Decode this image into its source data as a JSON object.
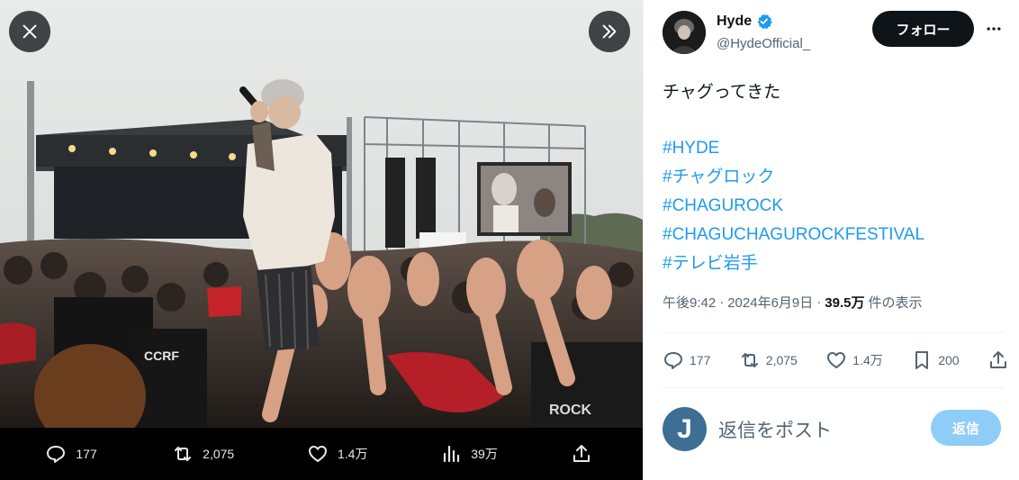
{
  "media_viewer": {
    "actions": {
      "reply_count": "177",
      "repost_count": "2,075",
      "like_count": "1.4万",
      "views_count": "39万"
    }
  },
  "author": {
    "display_name": "Hyde",
    "handle": "@HydeOfficial_",
    "follow_label": "フォロー"
  },
  "tweet": {
    "text": "チャグってきた",
    "hashtags": [
      "#HYDE",
      "#チャグロック",
      "#CHAGUROCK",
      "#CHAGUCHAGUROCKFESTIVAL",
      "#テレビ岩手"
    ],
    "time": "午後9:42",
    "separator": "·",
    "date": "2024年6月9日",
    "views": "39.5万",
    "views_label": "件の表示"
  },
  "stats": {
    "replies": "177",
    "reposts": "2,075",
    "likes": "1.4万",
    "bookmarks": "200"
  },
  "reply": {
    "avatar_initial": "J",
    "placeholder": "返信をポスト",
    "button_label": "返信"
  },
  "colors": {
    "accent": "#1d9bf0",
    "verified": "#1d9bf0",
    "follow_bg": "#0f1419",
    "reply_disabled": "#8ecdf7",
    "reply_avatar": "#3d6e93"
  }
}
